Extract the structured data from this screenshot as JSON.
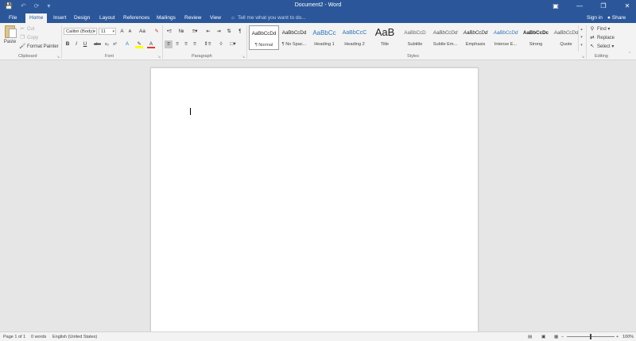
{
  "window": {
    "title": "Document2 - Word"
  },
  "quick_access": {
    "save_icon": "save-icon",
    "undo_icon": "undo-icon",
    "redo_icon": "redo-icon",
    "customize_icon": "customize-qat-icon"
  },
  "window_controls": {
    "ribbon_display_icon": "ribbon-display-options-icon",
    "minimize_icon": "minimize-icon",
    "restore_icon": "restore-icon",
    "close_icon": "close-icon"
  },
  "tabs": [
    {
      "label": "File"
    },
    {
      "label": "Home"
    },
    {
      "label": "Insert"
    },
    {
      "label": "Design"
    },
    {
      "label": "Layout"
    },
    {
      "label": "References"
    },
    {
      "label": "Mailings"
    },
    {
      "label": "Review"
    },
    {
      "label": "View"
    }
  ],
  "active_tab": "Home",
  "tell_me": "Tell me what you want to do...",
  "account": {
    "sign_in": "Sign in",
    "share": "Share"
  },
  "clipboard": {
    "paste": "Paste",
    "cut": "Cut",
    "copy": "Copy",
    "format_painter": "Format Painter",
    "group_label": "Clipboard"
  },
  "font": {
    "name": "Calibri (Body)",
    "size": "11",
    "group_label": "Font",
    "bold": "B",
    "italic": "I",
    "underline": "U",
    "strikethrough": "abc",
    "subscript": "x₂",
    "superscript": "x²",
    "text_effects": "A",
    "font_color": "A",
    "grow": "A",
    "shrink": "A",
    "change_case": "Aa"
  },
  "paragraph": {
    "group_label": "Paragraph"
  },
  "styles": {
    "group_label": "Styles",
    "items": [
      {
        "sample": "AaBbCcDd",
        "name": "¶ Normal"
      },
      {
        "sample": "AaBbCcDd",
        "name": "¶ No Spac..."
      },
      {
        "sample": "AaBbCc",
        "name": "Heading 1"
      },
      {
        "sample": "AaBbCcC",
        "name": "Heading 2"
      },
      {
        "sample": "AaB",
        "name": "Title"
      },
      {
        "sample": "AaBbCcD",
        "name": "Subtitle"
      },
      {
        "sample": "AaBbCcDd",
        "name": "Subtle Em..."
      },
      {
        "sample": "AaBbCcDd",
        "name": "Emphasis"
      },
      {
        "sample": "AaBbCcDd",
        "name": "Intense E..."
      },
      {
        "sample": "AaBbCcDc",
        "name": "Strong"
      },
      {
        "sample": "AaBbCcDd",
        "name": "Quote"
      }
    ]
  },
  "editing": {
    "find": "Find",
    "replace": "Replace",
    "select": "Select",
    "group_label": "Editing"
  },
  "status_bar": {
    "page": "Page 1 of 1",
    "words": "0 words",
    "language": "English (United States)",
    "zoom": "100%"
  },
  "colors": {
    "brand": "#2b579a",
    "ribbon_bg": "#f3f3f3",
    "canvas_bg": "#e6e6e6"
  }
}
